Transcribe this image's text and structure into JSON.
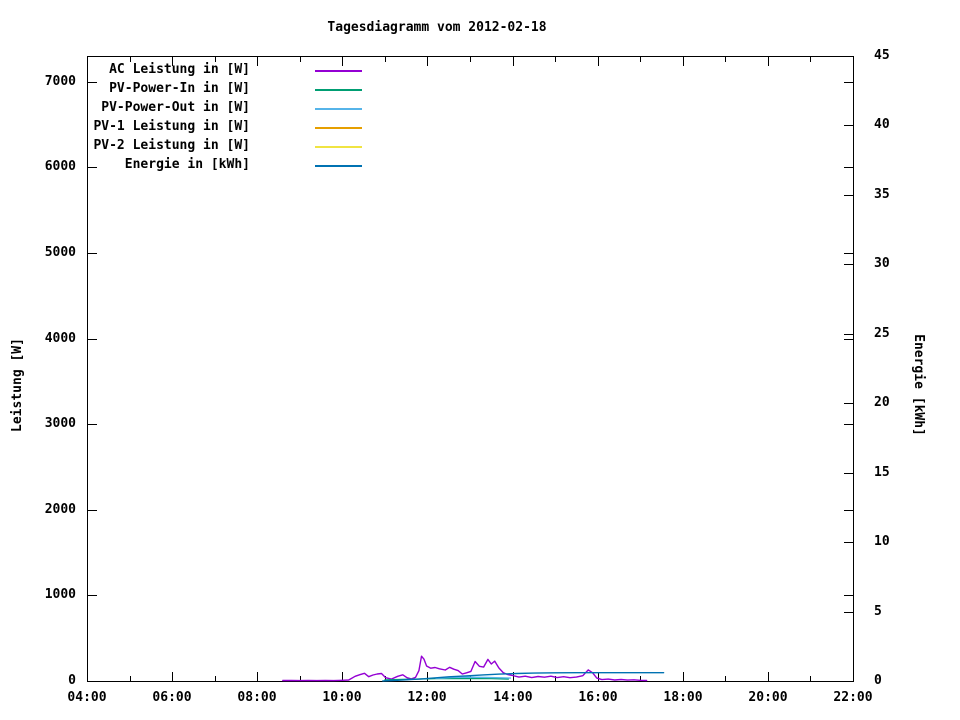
{
  "chart_data": {
    "type": "line",
    "title": "Tagesdiagramm vom 2012-02-18",
    "grid": false,
    "legend_position": "top-left-inside",
    "x_axis": {
      "unit": "time",
      "min_hour": 4,
      "max_hour": 22,
      "major_ticks": [
        4,
        6,
        8,
        10,
        12,
        14,
        16,
        18,
        20,
        22
      ],
      "major_tick_labels": [
        "04:00",
        "06:00",
        "08:00",
        "10:00",
        "12:00",
        "14:00",
        "16:00",
        "18:00",
        "20:00",
        "22:00"
      ],
      "minor_ticks": [
        5,
        7,
        9,
        11,
        13,
        15,
        17,
        19,
        21
      ]
    },
    "y_axis_left": {
      "label": "Leistung [W]",
      "min": 0,
      "max": 7300,
      "ticks": [
        0,
        1000,
        2000,
        3000,
        4000,
        5000,
        6000,
        7000
      ],
      "tick_labels": [
        "0",
        "1000",
        "2000",
        "3000",
        "4000",
        "5000",
        "6000",
        "7000"
      ]
    },
    "y_axis_right": {
      "label": "Energie [kWh]",
      "min": 0,
      "max": 45,
      "ticks": [
        0,
        5,
        10,
        15,
        20,
        25,
        30,
        35,
        40,
        45
      ],
      "tick_labels": [
        "0",
        "5",
        "10",
        "15",
        "20",
        "25",
        "30",
        "35",
        "40",
        "45"
      ]
    },
    "series": [
      {
        "name": "AC Leistung in [W]",
        "color": "#9400D3",
        "axis": "left",
        "points": [
          [
            8.6,
            6
          ],
          [
            8.8,
            6
          ],
          [
            9.0,
            5
          ],
          [
            9.2,
            7
          ],
          [
            9.4,
            5
          ],
          [
            9.6,
            6
          ],
          [
            9.8,
            5
          ],
          [
            10.0,
            8
          ],
          [
            10.15,
            12
          ],
          [
            10.3,
            55
          ],
          [
            10.42,
            75
          ],
          [
            10.52,
            90
          ],
          [
            10.62,
            50
          ],
          [
            10.72,
            70
          ],
          [
            10.82,
            82
          ],
          [
            10.92,
            88
          ],
          [
            11.02,
            38
          ],
          [
            11.15,
            22
          ],
          [
            11.3,
            55
          ],
          [
            11.42,
            72
          ],
          [
            11.52,
            38
          ],
          [
            11.62,
            25
          ],
          [
            11.72,
            42
          ],
          [
            11.8,
            120
          ],
          [
            11.86,
            290
          ],
          [
            11.92,
            255
          ],
          [
            11.98,
            175
          ],
          [
            12.08,
            150
          ],
          [
            12.18,
            158
          ],
          [
            12.28,
            142
          ],
          [
            12.42,
            128
          ],
          [
            12.52,
            160
          ],
          [
            12.62,
            138
          ],
          [
            12.72,
            122
          ],
          [
            12.82,
            82
          ],
          [
            12.92,
            96
          ],
          [
            13.02,
            112
          ],
          [
            13.12,
            228
          ],
          [
            13.22,
            172
          ],
          [
            13.32,
            162
          ],
          [
            13.42,
            252
          ],
          [
            13.5,
            198
          ],
          [
            13.58,
            232
          ],
          [
            13.68,
            152
          ],
          [
            13.78,
            98
          ],
          [
            13.88,
            76
          ],
          [
            14.0,
            64
          ],
          [
            14.15,
            46
          ],
          [
            14.3,
            56
          ],
          [
            14.45,
            40
          ],
          [
            14.6,
            52
          ],
          [
            14.75,
            44
          ],
          [
            14.9,
            56
          ],
          [
            15.05,
            40
          ],
          [
            15.2,
            50
          ],
          [
            15.35,
            38
          ],
          [
            15.5,
            46
          ],
          [
            15.65,
            62
          ],
          [
            15.78,
            130
          ],
          [
            15.88,
            96
          ],
          [
            15.98,
            34
          ],
          [
            16.1,
            16
          ],
          [
            16.25,
            22
          ],
          [
            16.4,
            12
          ],
          [
            16.55,
            18
          ],
          [
            16.7,
            10
          ],
          [
            16.85,
            14
          ],
          [
            17.0,
            8
          ],
          [
            17.15,
            6
          ]
        ]
      },
      {
        "name": "PV-Power-In in [W]",
        "color": "#009E73",
        "axis": "left",
        "points": [
          [
            11.0,
            12
          ],
          [
            11.4,
            18
          ],
          [
            11.8,
            22
          ],
          [
            12.2,
            28
          ],
          [
            12.6,
            30
          ],
          [
            13.0,
            28
          ],
          [
            13.4,
            30
          ],
          [
            13.9,
            22
          ]
        ]
      },
      {
        "name": "PV-Power-Out in [W]",
        "color": "#56B4E9",
        "axis": "left",
        "points": [
          [
            12.2,
            30
          ],
          [
            12.6,
            42
          ],
          [
            13.0,
            44
          ],
          [
            13.4,
            42
          ],
          [
            13.95,
            34
          ]
        ]
      },
      {
        "name": "PV-1 Leistung in [W]",
        "color": "#E69F00",
        "axis": "left",
        "points": []
      },
      {
        "name": "PV-2 Leistung in [W]",
        "color": "#F0E442",
        "axis": "left",
        "points": []
      },
      {
        "name": "Energie in [kWh]",
        "color": "#0072B2",
        "axis": "right",
        "points": [
          [
            10.95,
            0.01
          ],
          [
            11.3,
            0.05
          ],
          [
            11.6,
            0.1
          ],
          [
            11.9,
            0.16
          ],
          [
            12.2,
            0.23
          ],
          [
            12.5,
            0.3
          ],
          [
            12.9,
            0.37
          ],
          [
            13.3,
            0.44
          ],
          [
            13.7,
            0.5
          ],
          [
            14.1,
            0.54
          ],
          [
            14.5,
            0.57
          ],
          [
            15.0,
            0.59
          ],
          [
            15.5,
            0.6
          ],
          [
            17.55,
            0.6
          ]
        ]
      }
    ]
  }
}
